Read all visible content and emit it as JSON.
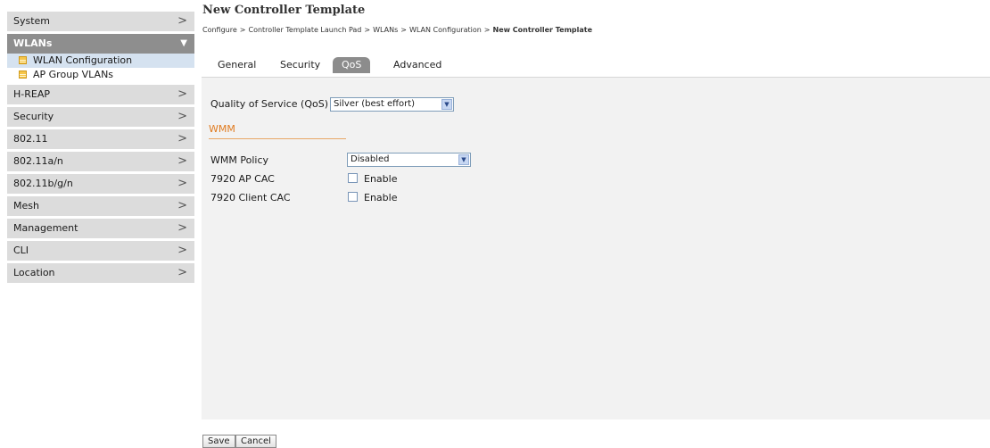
{
  "sidebar": {
    "items": [
      {
        "label": "System",
        "chevron": ">"
      },
      {
        "label": "WLANs",
        "chevron": "v",
        "expanded": true,
        "children": [
          {
            "label": "WLAN Configuration",
            "icon": "table-icon",
            "selected": true
          },
          {
            "label": "AP Group VLANs",
            "icon": "table-icon",
            "selected": false
          }
        ]
      },
      {
        "label": "H-REAP",
        "chevron": ">"
      },
      {
        "label": "Security",
        "chevron": ">"
      },
      {
        "label": "802.11",
        "chevron": ">"
      },
      {
        "label": "802.11a/n",
        "chevron": ">"
      },
      {
        "label": "802.11b/g/n",
        "chevron": ">"
      },
      {
        "label": "Mesh",
        "chevron": ">"
      },
      {
        "label": "Management",
        "chevron": ">"
      },
      {
        "label": "CLI",
        "chevron": ">"
      },
      {
        "label": "Location",
        "chevron": ">"
      }
    ]
  },
  "header": {
    "title": "New Controller Template",
    "breadcrumb": [
      "Configure",
      "Controller Template Launch Pad",
      "WLANs",
      "WLAN Configuration",
      "New Controller Template"
    ],
    "separator": ">"
  },
  "tabs": [
    {
      "label": "General",
      "active": false
    },
    {
      "label": "Security",
      "active": false
    },
    {
      "label": "QoS",
      "active": true
    },
    {
      "label": "Advanced",
      "active": false
    }
  ],
  "form": {
    "qos_label": "Quality of Service (QoS)",
    "qos_value": "Silver (best effort)",
    "wmm_section_title": "WMM",
    "wmm_policy_label": "WMM Policy",
    "wmm_policy_value": "Disabled",
    "ap_cac_label": "7920 AP CAC",
    "ap_cac_checkbox_label": "Enable",
    "ap_cac_checked": false,
    "client_cac_label": "7920 Client CAC",
    "client_cac_checkbox_label": "Enable",
    "client_cac_checked": false
  },
  "buttons": {
    "save": "Save",
    "cancel": "Cancel"
  },
  "colors": {
    "sidebar_bg": "#dcdcdc",
    "sidebar_active_bg": "#8e8e8e",
    "selected_sub_bg": "#d5e2f0",
    "panel_bg": "#f2f2f2",
    "section_accent": "#e07b20",
    "active_tab_bg": "#8c8c8c"
  }
}
